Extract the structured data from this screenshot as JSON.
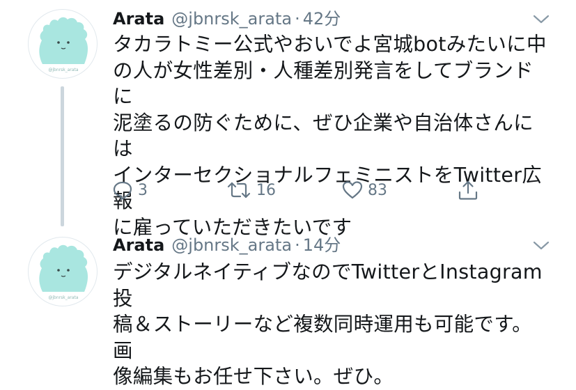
{
  "tweets": [
    {
      "author_name": "Arata",
      "handle": "@jbnrsk_arata",
      "separator": "·",
      "time": "42分",
      "text": "タカラトミー公式やおいでよ宮城botみたいに中\nの人が女性差別・人種差別発言をしてブランドに\n泥塗るの防ぐために、ぜひ企業や自治体さんには\nインターセクショナルフェミニストをTwitter広報\nに雇っていただきたいです",
      "reply_count": "3",
      "retweet_count": "16",
      "like_count": "83",
      "avatar_icon": "flame-ghost-avatar-icon"
    },
    {
      "author_name": "Arata",
      "handle": "@jbnrsk_arata",
      "separator": "·",
      "time": "14分",
      "text": "デジタルネイティブなのでTwitterとInstagram投\n稿＆ストーリーなど複数同時運用も可能です。画\n像編集もお任せ下さい。ぜひ。",
      "avatar_icon": "flame-ghost-avatar-icon"
    }
  ],
  "colors": {
    "text_primary": "#14171a",
    "text_secondary": "#657786",
    "thread_line": "#ccd6dd",
    "avatar_fill": "#a9e6e0"
  }
}
